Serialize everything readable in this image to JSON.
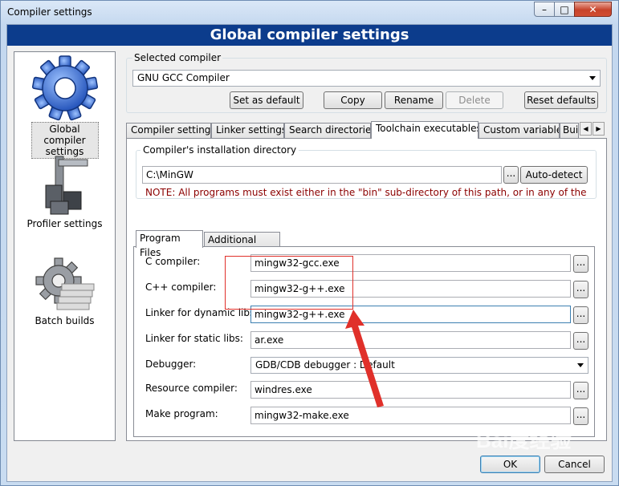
{
  "window": {
    "title": "Compiler settings",
    "controls": {
      "minimize": "–",
      "maximize": "□",
      "close": "✕"
    }
  },
  "banner": "Global compiler settings",
  "sidebar": {
    "items": [
      {
        "label": "Global compiler settings",
        "icon": "gear-icon",
        "selected": true
      },
      {
        "label": "Profiler settings",
        "icon": "caliper-icon",
        "selected": false
      },
      {
        "label": "Batch builds",
        "icon": "batch-gear-icon",
        "selected": false
      }
    ]
  },
  "selected_compiler": {
    "group_label": "Selected compiler",
    "value": "GNU GCC Compiler"
  },
  "compiler_buttons": {
    "set_default": "Set as default",
    "copy": "Copy",
    "rename": "Rename",
    "delete": "Delete",
    "reset_defaults": "Reset defaults"
  },
  "tabs": [
    {
      "label": "Compiler settings"
    },
    {
      "label": "Linker settings"
    },
    {
      "label": "Search directories"
    },
    {
      "label": "Toolchain executables",
      "active": true
    },
    {
      "label": "Custom variables"
    },
    {
      "label": "Bui"
    }
  ],
  "tab_scroll": {
    "left": "◀",
    "right": "▶"
  },
  "install_dir": {
    "group_label": "Compiler's installation directory",
    "value": "C:\\MinGW",
    "browse_label": "...",
    "autodetect_label": "Auto-detect",
    "note": "NOTE: All programs must exist either in the \"bin\" sub-directory of this path, or in any of the"
  },
  "subtabs": [
    {
      "label": "Program Files",
      "active": true
    },
    {
      "label": "Additional Paths"
    }
  ],
  "programs": [
    {
      "label": "C compiler:",
      "value": "mingw32-gcc.exe"
    },
    {
      "label": "C++ compiler:",
      "value": "mingw32-g++.exe"
    },
    {
      "label": "Linker for dynamic libs:",
      "value": "mingw32-g++.exe"
    },
    {
      "label": "Linker for static libs:",
      "value": "ar.exe"
    },
    {
      "label": "Debugger:",
      "value": "GDB/CDB debugger : Default"
    },
    {
      "label": "Resource compiler:",
      "value": "windres.exe"
    },
    {
      "label": "Make program:",
      "value": "mingw32-make.exe"
    }
  ],
  "browse_label": "...",
  "dialog_buttons": {
    "ok": "OK",
    "cancel": "Cancel"
  },
  "watermark": "Bai度经验",
  "annotation_color": "#e0302a",
  "banner_color": "#0c3c8c"
}
